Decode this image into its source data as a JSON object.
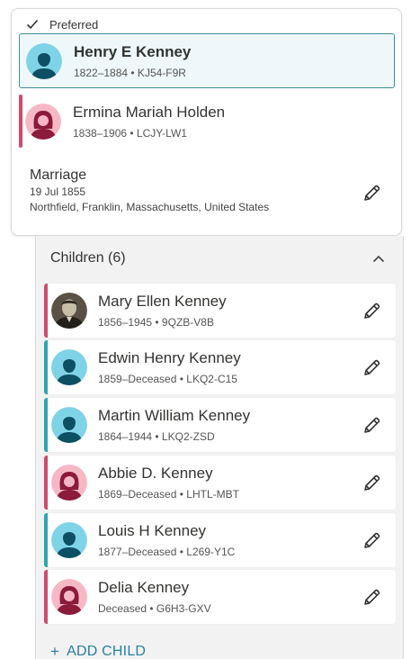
{
  "couple": {
    "preferred_label": "Preferred",
    "husband": {
      "name": "Henry E Kenney",
      "meta": "1822–1884 • KJ54-F9R",
      "gender": "male"
    },
    "wife": {
      "name": "Ermina Mariah Holden",
      "meta": "1838–1906 • LCJY-LW1",
      "gender": "female"
    },
    "marriage": {
      "title": "Marriage",
      "date": "19 Jul 1855",
      "place": "Northfield, Franklin, Massachusetts, United States"
    }
  },
  "children": {
    "header": "Children (6)",
    "items": [
      {
        "name": "Mary Ellen Kenney",
        "meta": "1856–1945 • 9QZB-V8B",
        "gender": "female",
        "avatar": "photo"
      },
      {
        "name": "Edwin Henry Kenney",
        "meta": "1859–Deceased • LKQ2-C15",
        "gender": "male",
        "avatar": "male-silhouette"
      },
      {
        "name": "Martin William Kenney",
        "meta": "1864–1944 • LKQ2-ZSD",
        "gender": "male",
        "avatar": "male-silhouette"
      },
      {
        "name": "Abbie D. Kenney",
        "meta": "1869–Deceased • LHTL-MBT",
        "gender": "female",
        "avatar": "female-silhouette"
      },
      {
        "name": "Louis H Kenney",
        "meta": "1877–Deceased • L269-Y1C",
        "gender": "male",
        "avatar": "male-silhouette"
      },
      {
        "name": "Delia Kenney",
        "meta": "Deceased • G6H3-GXV",
        "gender": "female",
        "avatar": "female-silhouette"
      }
    ],
    "add_label": "ADD CHILD"
  },
  "colors": {
    "male_accent": "#2aa5b3",
    "female_accent": "#d04a6e",
    "link": "#2a7fa0"
  },
  "icons": {
    "check": "check-icon",
    "edit": "pencil-icon",
    "collapse": "chevron-up-icon",
    "add": "plus-icon"
  }
}
